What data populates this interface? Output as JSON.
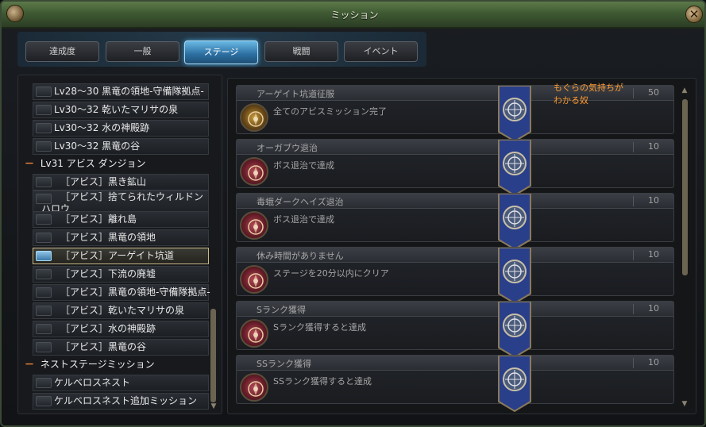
{
  "window": {
    "title": "ミッション",
    "close_label": "✕"
  },
  "tabs": [
    {
      "label": "達成度",
      "active": false
    },
    {
      "label": "一般",
      "active": false
    },
    {
      "label": "ステージ",
      "active": true
    },
    {
      "label": "戦闘",
      "active": false
    },
    {
      "label": "イベント",
      "active": false
    }
  ],
  "left_list": {
    "items": [
      {
        "label": "Lv28～30 黒竜の領地-守備隊拠点-"
      },
      {
        "label": "Lv30～32 乾いたマリサの泉"
      },
      {
        "label": "Lv30～32 水の神殿跡"
      },
      {
        "label": "Lv30～32 黒竜の谷"
      }
    ],
    "category_abyss": {
      "toggle": "－",
      "label": "Lv31 アビス ダンジョン"
    },
    "abyss_items": [
      {
        "label": "［アビス］黒き鉱山"
      },
      {
        "label_line1": "［アビス］捨てられたウィルドン",
        "label_line2": "ハロウ"
      },
      {
        "label": "［アビス］離れ島"
      },
      {
        "label": "［アビス］黒竜の領地"
      },
      {
        "label": "［アビス］アーゲイト坑道",
        "selected": true
      },
      {
        "label": "［アビス］下流の廃墟"
      },
      {
        "label": "［アビス］黒竜の領地-守備隊拠点-"
      },
      {
        "label": "［アビス］乾いたマリサの泉"
      },
      {
        "label": "［アビス］水の神殿跡"
      },
      {
        "label": "［アビス］黒竜の谷"
      }
    ],
    "category_nest": {
      "toggle": "－",
      "label": "ネストステージミッション"
    },
    "nest_items": [
      {
        "label": "ケルベロスネスト"
      },
      {
        "label": "ケルベロスネスト追加ミッション"
      }
    ]
  },
  "missions": [
    {
      "title": "アーゲイト坑道征服",
      "points": "50",
      "desc": "全てのアビスミッション完了",
      "icon": "gold-crest-icon"
    },
    {
      "title": "オーガブウ退治",
      "points": "10",
      "desc": "ボス退治で達成",
      "icon": "red-crest-icon"
    },
    {
      "title": "毒蛾ダークヘイズ退治",
      "points": "10",
      "desc": "ボス退治で達成",
      "icon": "red-crest-icon"
    },
    {
      "title": "休み時間がありません",
      "points": "10",
      "desc": "ステージを20分以内にクリア",
      "icon": "red-crest-icon"
    },
    {
      "title": "Sランク獲得",
      "points": "10",
      "desc": "Sランク獲得すると達成",
      "icon": "red-crest-icon"
    },
    {
      "title": "SSランク獲得",
      "points": "10",
      "desc": "SSランク獲得すると達成",
      "icon": "red-crest-icon"
    }
  ],
  "annotation": {
    "line1": "もぐらの気持ちが",
    "line2": "わかる奴"
  },
  "colors": {
    "accent": "#4aa0d8",
    "note": "#ff9a2e",
    "frame": "#3f5a33"
  }
}
